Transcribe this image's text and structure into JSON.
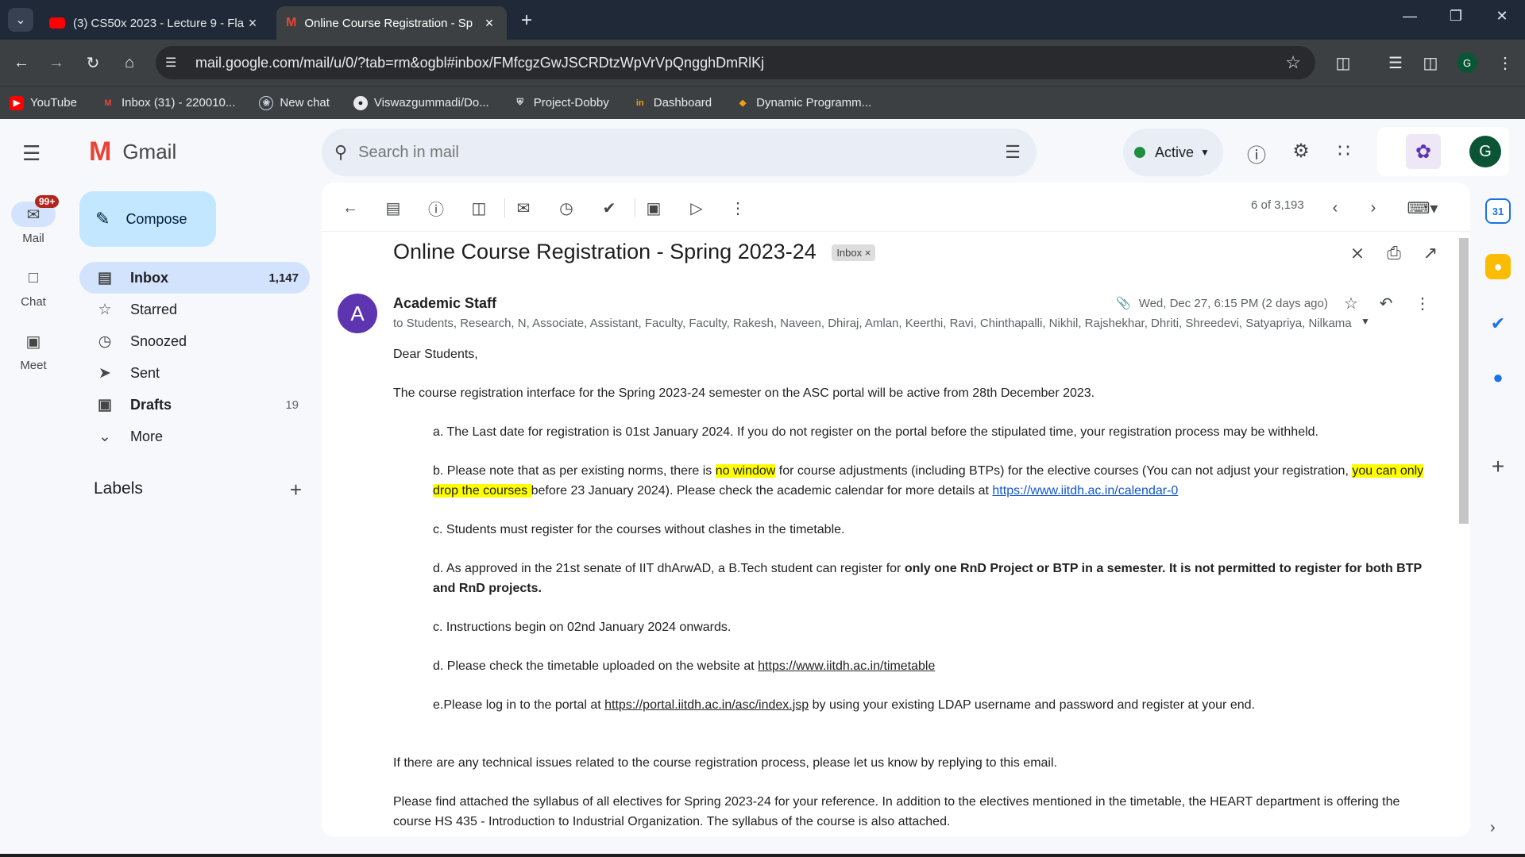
{
  "browser": {
    "tabs": [
      {
        "title": "(3) CS50x 2023 - Lecture 9 - Fla",
        "icon": "youtube-icon"
      },
      {
        "title": "Online Course Registration - Sp",
        "icon": "gmail-icon"
      }
    ],
    "url": "mail.google.com/mail/u/0/?tab=rm&ogbl#inbox/FMfcgzGwJSCRDtzWpVrVpQngghDmRlKj",
    "profile_initial": "G",
    "bookmarks": [
      {
        "label": "YouTube",
        "icon": "youtube-icon"
      },
      {
        "label": "Inbox (31) - 220010...",
        "icon": "gmail-icon"
      },
      {
        "label": "New chat",
        "icon": "chatgpt-icon"
      },
      {
        "label": "Viswazgummadi/Do...",
        "icon": "github-icon"
      },
      {
        "label": "Project-Dobby",
        "icon": "shield-icon"
      },
      {
        "label": "Dashboard",
        "icon": "dashboard-icon"
      },
      {
        "label": "Dynamic Programm...",
        "icon": "code-icon"
      }
    ]
  },
  "gmail": {
    "brand": "Gmail",
    "rail": {
      "mail_label": "Mail",
      "mail_badge": "99+",
      "chat_label": "Chat",
      "meet_label": "Meet"
    },
    "compose_label": "Compose",
    "nav": [
      {
        "label": "Inbox",
        "count": "1,147",
        "icon": "inbox-icon"
      },
      {
        "label": "Starred",
        "count": "",
        "icon": "star-icon"
      },
      {
        "label": "Snoozed",
        "count": "",
        "icon": "clock-icon"
      },
      {
        "label": "Sent",
        "count": "",
        "icon": "send-icon"
      },
      {
        "label": "Drafts",
        "count": "19",
        "icon": "draft-icon"
      },
      {
        "label": "More",
        "count": "",
        "icon": "chevron-down-icon"
      }
    ],
    "labels_heading": "Labels",
    "search_placeholder": "Search in mail",
    "status_label": "Active",
    "status_color": "#1e8e3e",
    "avatar_initial": "G"
  },
  "message": {
    "pager": "6 of 3,193",
    "subject": "Online Course Registration - Spring 2023-24",
    "label_tag": "Inbox",
    "sender_initial": "A",
    "sender_name": "Academic Staff",
    "date": "Wed, Dec 27, 6:15 PM (2 days ago)",
    "recipients": "to Students, Research, N, Associate, Assistant, Faculty, Faculty, Rakesh, Naveen, Dhiraj, Amlan, Keerthi, Ravi, Chinthapalli, Nikhil, Rajshekhar, Dhriti, Shreedevi, Satyapriya, Nilkama",
    "greeting": "Dear Students,",
    "intro": "The course registration interface for the Spring 2023-24 semester on the ASC portal will be active from 28th December 2023.",
    "item_a": "a. The Last date for registration is 01st January 2024. If you do not register on the portal before the stipulated time, your registration process may be withheld.",
    "item_b_1": "b. Please note that as per existing norms, there is ",
    "item_b_hl1": "no window",
    "item_b_2": " for course adjustments (including BTPs) for the elective courses (You can not adjust your registration, ",
    "item_b_hl2": "you can only drop the courses ",
    "item_b_3": "before 23 January 2024). Please check the academic calendar for more details at ",
    "item_b_link": "https://www.iitdh.ac.in/calendar-0",
    "item_c": "c. Students must register for the courses without clashes in the timetable.",
    "item_d_1": "d. As approved in the 21st senate of IIT dhArwAD, a B.Tech student can register for ",
    "item_d_bold": "only one RnD Project or BTP in a semester. It is not permitted to register for both BTP and RnD projects.",
    "item_c2": "c. Instructions begin on 02nd January 2024 onwards.",
    "item_d2_1": "d. Please check the timetable uploaded on the website at ",
    "item_d2_link": "https://www.iitdh.ac.in/timetable",
    "item_e_1": "e.Please log in to the portal at ",
    "item_e_link": "https://portal.iitdh.ac.in/asc/index.jsp",
    "item_e_2": " by using your existing LDAP username and password and register at your end.",
    "issues": "If there are any technical issues related to the course registration process, please let us know by replying to this email.",
    "syllabus": "Please find attached the syllabus of all electives for Spring 2023-24 for your reference. In addition to the electives mentioned in the timetable, the HEART department is offering the course HS 435 - Introduction to Industrial Organization. The syllabus of the course is also attached."
  }
}
